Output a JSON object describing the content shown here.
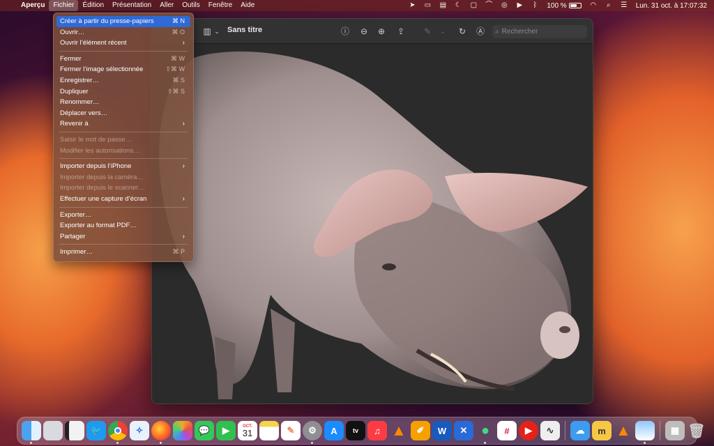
{
  "menubar": {
    "apple_icon": "apple-logo-icon",
    "app_name": "Aperçu",
    "menus": [
      "Fichier",
      "Édition",
      "Présentation",
      "Aller",
      "Outils",
      "Fenêtre",
      "Aide"
    ],
    "status": {
      "battery_text": "100 %",
      "clock": "Lun. 31 oct. à 17:07:32"
    }
  },
  "window": {
    "title": "Sans titre",
    "search_placeholder": "Rechercher"
  },
  "file_menu": {
    "items": [
      {
        "label": "Créer à partir du presse-papiers",
        "shortcut": "⌘ N",
        "state": "highlighted"
      },
      {
        "label": "Ouvrir…",
        "shortcut": "⌘ O",
        "state": "enabled"
      },
      {
        "label": "Ouvrir l’élément récent",
        "shortcut": "",
        "state": "submenu"
      },
      {
        "label": "Fermer",
        "shortcut": "⌘ W",
        "state": "enabled"
      },
      {
        "label": "Fermer l’image sélectionnée",
        "shortcut": "⇧⌘ W",
        "state": "enabled"
      },
      {
        "label": "Enregistrer…",
        "shortcut": "⌘ S",
        "state": "enabled"
      },
      {
        "label": "Dupliquer",
        "shortcut": "⇧⌘ S",
        "state": "enabled"
      },
      {
        "label": "Renommer…",
        "shortcut": "",
        "state": "enabled"
      },
      {
        "label": "Déplacer vers…",
        "shortcut": "",
        "state": "enabled"
      },
      {
        "label": "Revenir à",
        "shortcut": "",
        "state": "submenu"
      },
      {
        "label": "Saisir le mot de passe…",
        "shortcut": "",
        "state": "disabled"
      },
      {
        "label": "Modifier les autorisations…",
        "shortcut": "",
        "state": "disabled"
      },
      {
        "label": "Importer depuis l’iPhone",
        "shortcut": "",
        "state": "submenu"
      },
      {
        "label": "Importer depuis la caméra…",
        "shortcut": "",
        "state": "disabled"
      },
      {
        "label": "Importer depuis le scanner…",
        "shortcut": "",
        "state": "disabled"
      },
      {
        "label": "Effectuer une capture d’écran",
        "shortcut": "",
        "state": "submenu"
      },
      {
        "label": "Exporter…",
        "shortcut": "",
        "state": "enabled"
      },
      {
        "label": "Exporter au format PDF…",
        "shortcut": "",
        "state": "enabled"
      },
      {
        "label": "Partager",
        "shortcut": "",
        "state": "submenu"
      },
      {
        "label": "Imprimer…",
        "shortcut": "⌘ P",
        "state": "enabled"
      }
    ]
  },
  "dock": {
    "calendar_month": "OCT.",
    "calendar_day": "31",
    "app_icons": [
      "finder-icon",
      "launchpad-icon",
      "notes-icon",
      "twitter-icon",
      "chrome-icon",
      "safari-icon",
      "firefox-icon",
      "photos-icon",
      "messages-icon",
      "facetime-icon",
      "calendar-icon",
      "notes-yellow-icon",
      "freeform-icon",
      "system-settings-icon",
      "app-store-icon",
      "apple-tv-icon",
      "music-icon",
      "vlc-icon",
      "pages-icon",
      "word-icon",
      "xcode-tools-icon",
      "android-icon",
      "slack-icon",
      "youtube-icon",
      "podcast-wave-icon",
      "weather-icon",
      "m-app-icon",
      "vlc-2-icon",
      "preview-icon",
      "archive-icon",
      "trash-icon"
    ]
  }
}
